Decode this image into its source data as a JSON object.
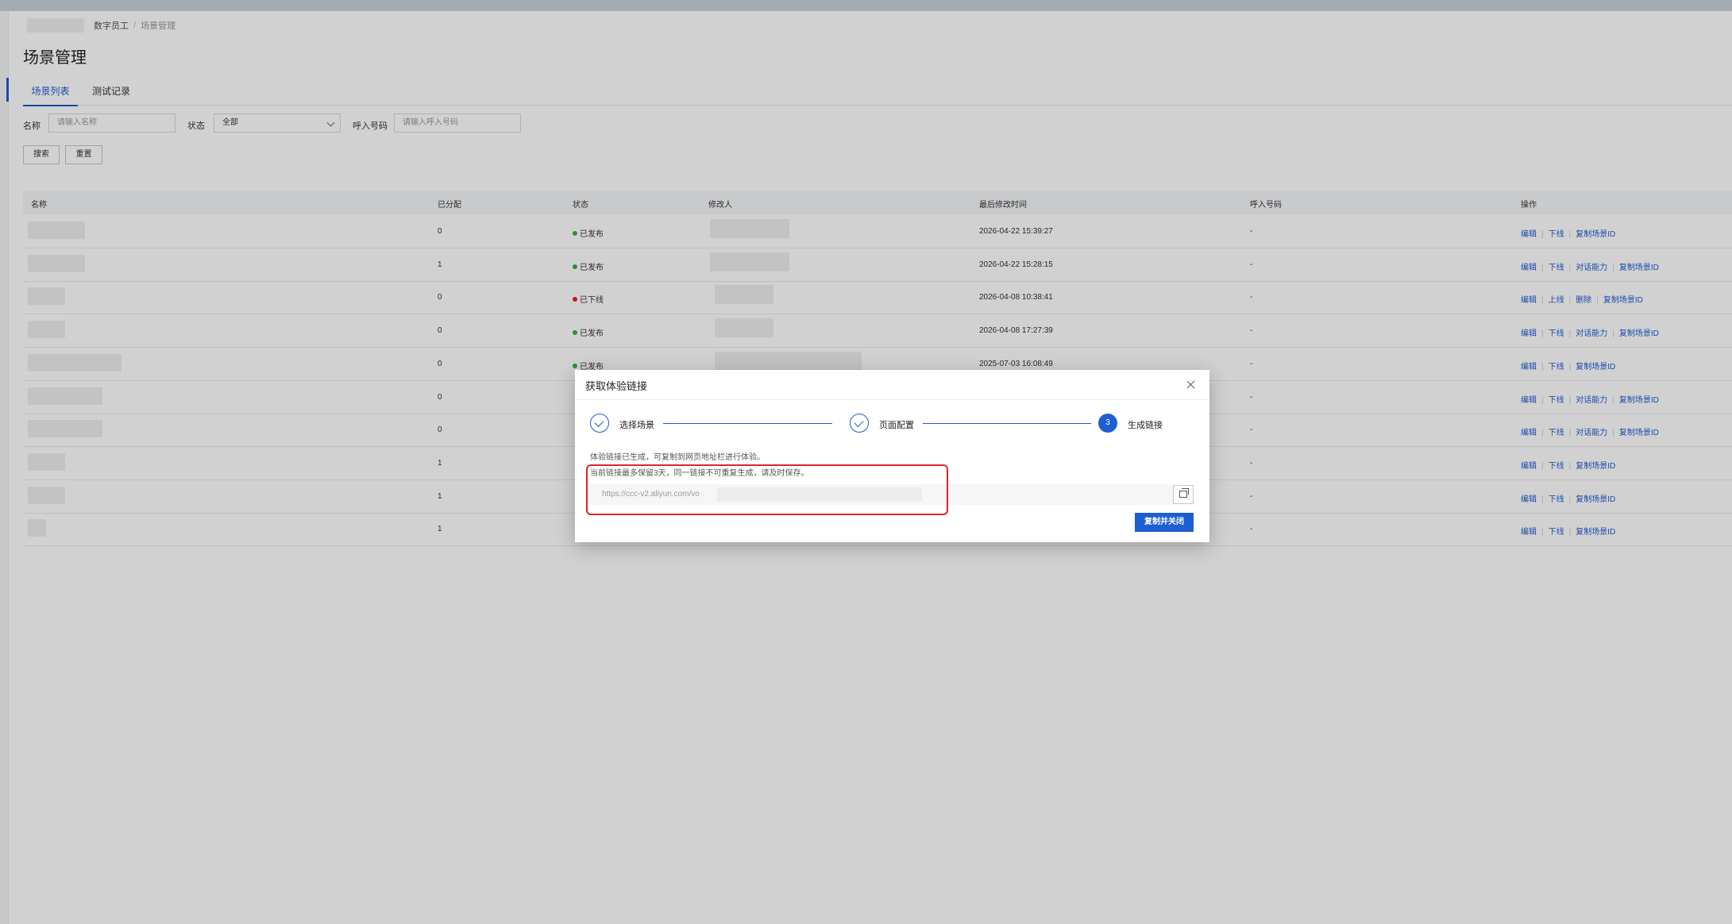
{
  "breadcrumb": {
    "parent": "数字员工",
    "separator": "/",
    "current": "场景管理"
  },
  "page_title": "场景管理",
  "tabs": [
    {
      "label": "场景列表",
      "active": true
    },
    {
      "label": "测试记录",
      "active": false
    }
  ],
  "filters": {
    "name_label": "名称",
    "name_placeholder": "请输入名称",
    "status_label": "状态",
    "status_value": "全部",
    "phone_label": "呼入号码",
    "phone_placeholder": "请输入呼入号码"
  },
  "buttons": {
    "search": "搜索",
    "reset": "重置"
  },
  "table": {
    "headers": [
      "名称",
      "已分配",
      "状态",
      "修改人",
      "最后修改时间",
      "呼入号码",
      "操作"
    ],
    "rows": [
      {
        "assigned": "0",
        "status": "已发布",
        "status_color": "#2fb344",
        "time": "2026-04-22 15:39:27",
        "phone": "-",
        "actions": [
          "编辑",
          "下线",
          "复制场景ID"
        ]
      },
      {
        "assigned": "1",
        "status": "已发布",
        "status_color": "#2fb344",
        "time": "2026-04-22 15:28:15",
        "phone": "-",
        "actions": [
          "编辑",
          "下线",
          "对话能力",
          "复制场景ID"
        ]
      },
      {
        "assigned": "0",
        "status": "已下线",
        "status_color": "#e1242b",
        "time": "2026-04-08 10:38:41",
        "phone": "-",
        "actions": [
          "编辑",
          "上线",
          "删除",
          "复制场景ID"
        ]
      },
      {
        "assigned": "0",
        "status": "已发布",
        "status_color": "#2fb344",
        "time": "2026-04-08 17:27:39",
        "phone": "-",
        "actions": [
          "编辑",
          "下线",
          "对话能力",
          "复制场景ID"
        ]
      },
      {
        "assigned": "0",
        "status": "已发布",
        "status_color": "#2fb344",
        "time": "2025-07-03 16:08:49",
        "phone": "-",
        "actions": [
          "编辑",
          "下线",
          "复制场景ID"
        ]
      },
      {
        "assigned": "0",
        "status": "",
        "status_color": "#2fb344",
        "time": "",
        "phone": "-",
        "actions": [
          "编辑",
          "下线",
          "对话能力",
          "复制场景ID"
        ]
      },
      {
        "assigned": "0",
        "status": "",
        "status_color": "#2fb344",
        "time": "",
        "phone": "-",
        "actions": [
          "编辑",
          "下线",
          "对话能力",
          "复制场景ID"
        ]
      },
      {
        "assigned": "1",
        "status": "",
        "status_color": "#2fb344",
        "time": "",
        "phone": "-",
        "actions": [
          "编辑",
          "下线",
          "复制场景ID"
        ]
      },
      {
        "assigned": "1",
        "status": "",
        "status_color": "#2fb344",
        "time": "",
        "phone": "-",
        "actions": [
          "编辑",
          "下线",
          "复制场景ID"
        ]
      },
      {
        "assigned": "1",
        "status": "",
        "status_color": "#2fb344",
        "time": "",
        "phone": "-",
        "actions": [
          "编辑",
          "下线",
          "复制场景ID"
        ]
      }
    ]
  },
  "modal": {
    "title": "获取体验链接",
    "steps": [
      {
        "label": "选择场景",
        "state": "done"
      },
      {
        "label": "页面配置",
        "state": "done"
      },
      {
        "label": "生成链接",
        "state": "current",
        "number": "3"
      }
    ],
    "info_line": "体验链接已生成，可复制到网页地址栏进行体验。",
    "warning_line": "当前链接最多保留3天，同一链接不可重复生成，请及时保存。",
    "url_value": "https://ccc-v2.aliyun.com/vo",
    "primary_button": "复制并关闭"
  },
  "colors": {
    "accent": "#1d5fd2",
    "highlight": "#e1242b"
  }
}
